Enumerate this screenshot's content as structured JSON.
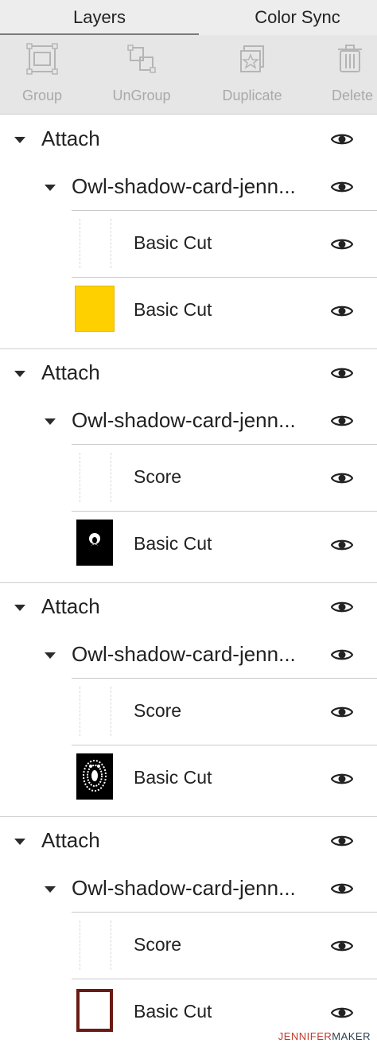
{
  "tabs": [
    {
      "label": "Layers",
      "active": true
    },
    {
      "label": "Color Sync",
      "active": false
    }
  ],
  "toolbar": {
    "group_label": "Group",
    "ungroup_label": "UnGroup",
    "duplicate_label": "Duplicate",
    "delete_label": "Delete",
    "disabled": true
  },
  "layers": [
    {
      "attach_label": "Attach",
      "image_label": "Owl-shadow-card-jenn...",
      "sub1_label": "Basic Cut",
      "sub2_label": "Basic Cut",
      "sub1_thumb": "none",
      "sub2_thumb": "yellow",
      "sub2_color": "#ffd000"
    },
    {
      "attach_label": "Attach",
      "image_label": "Owl-shadow-card-jenn...",
      "sub1_label": "Score",
      "sub2_label": "Basic Cut",
      "sub1_thumb": "none",
      "sub2_thumb": "black-owl-silhouette"
    },
    {
      "attach_label": "Attach",
      "image_label": "Owl-shadow-card-jenn...",
      "sub1_label": "Score",
      "sub2_label": "Basic Cut",
      "sub1_thumb": "none",
      "sub2_thumb": "black-owl-pattern"
    },
    {
      "attach_label": "Attach",
      "image_label": "Owl-shadow-card-jenn...",
      "sub1_label": "Score",
      "sub2_label": "Basic Cut",
      "sub1_thumb": "none",
      "sub2_thumb": "maroon-frame",
      "sub2_color": "#6b1a14"
    }
  ],
  "watermark": {
    "part1": "JENNIFER",
    "part2": "MAKER"
  },
  "icons": {
    "visibility": "eye-icon",
    "expand": "caret-down-icon",
    "group": "group-icon",
    "ungroup": "ungroup-icon",
    "duplicate": "duplicate-icon",
    "delete": "trash-icon"
  }
}
